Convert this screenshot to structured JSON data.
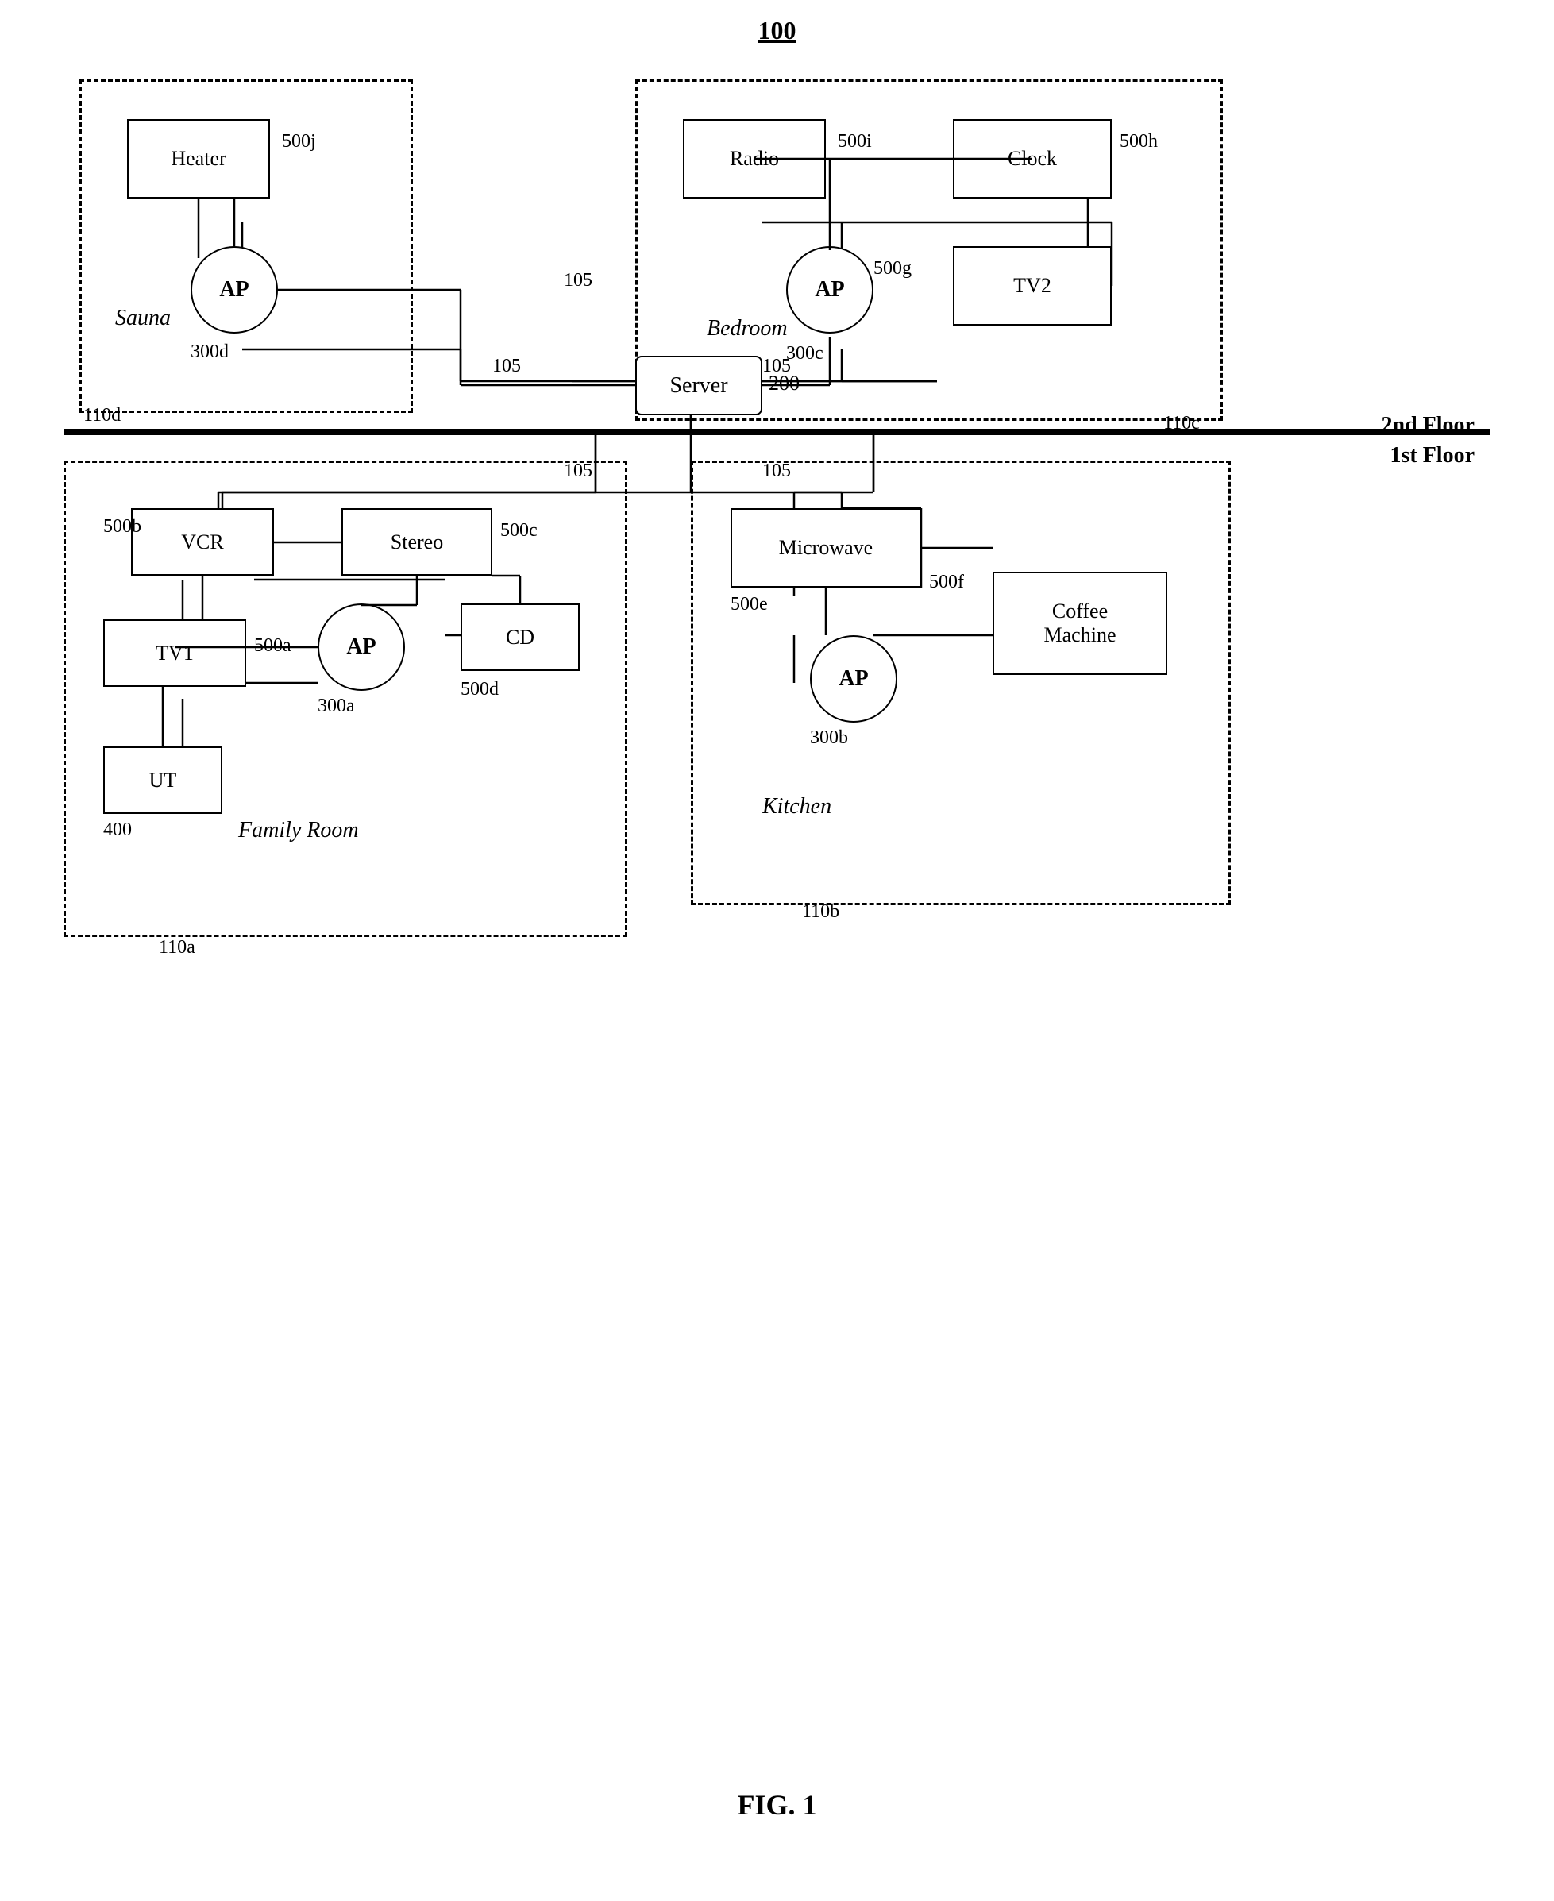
{
  "figure": {
    "number": "100",
    "label": "FIG. 1"
  },
  "floors": {
    "second": "2nd Floor",
    "first": "1st Floor"
  },
  "rooms": {
    "sauna": {
      "label": "Sauna",
      "id": "110d"
    },
    "bedroom": {
      "label": "Bedroom",
      "id": "110c"
    },
    "family_room": {
      "label": "Family Room",
      "id": "110a"
    },
    "kitchen": {
      "label": "Kitchen",
      "id": "110b"
    }
  },
  "devices": {
    "heater": {
      "label": "Heater",
      "id": "500j"
    },
    "radio": {
      "label": "Radio",
      "id": "500i"
    },
    "clock": {
      "label": "Clock",
      "id": "500h"
    },
    "tv2": {
      "label": "TV2",
      "id": "500g"
    },
    "server": {
      "label": "Server",
      "id": "200"
    },
    "vcr": {
      "label": "VCR",
      "id": "500b"
    },
    "stereo": {
      "label": "Stereo",
      "id": "500c"
    },
    "tv1": {
      "label": "TV1",
      "id": "500a"
    },
    "cd": {
      "label": "CD",
      "id": "500d"
    },
    "ut": {
      "label": "UT",
      "id": "400"
    },
    "microwave": {
      "label": "Microwave",
      "id": "500e"
    },
    "coffee_machine": {
      "label": "Coffee\nMachine",
      "id": "500f"
    }
  },
  "aps": {
    "ap_300a": {
      "label": "AP",
      "id": "300a"
    },
    "ap_300b": {
      "label": "AP",
      "id": "300b"
    },
    "ap_300c": {
      "label": "AP",
      "id": "300c"
    },
    "ap_300d": {
      "label": "AP",
      "id": "300d"
    }
  },
  "connections": {
    "label": "105"
  },
  "colors": {
    "bg": "#ffffff",
    "border": "#000000",
    "dashed": "#000000"
  }
}
